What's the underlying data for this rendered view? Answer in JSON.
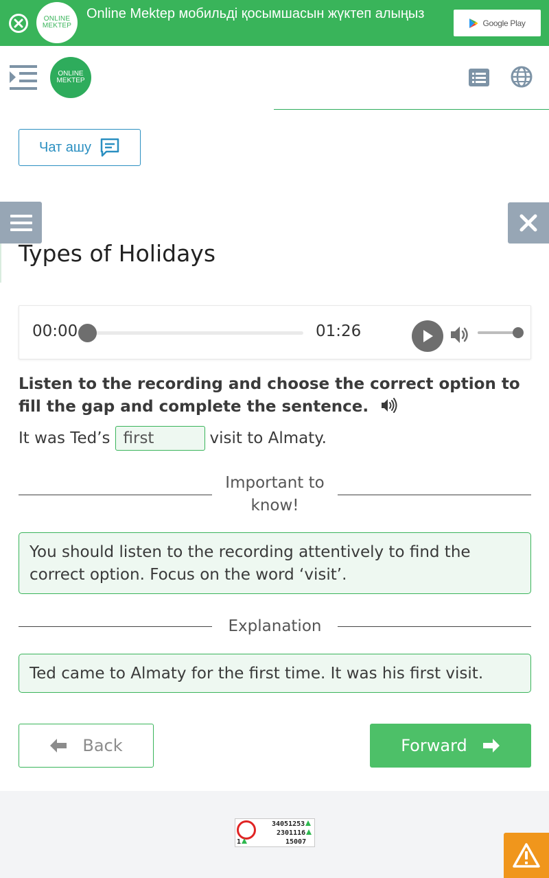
{
  "banner": {
    "logo_line1": "ONLINE",
    "logo_line2": "MEKTEP",
    "text": "Online Mektep мобильді қосымшасын жүктеп алыңыз",
    "store_label": "Google Play"
  },
  "header": {
    "logo_line1": "ONLINE",
    "logo_line2": "MEKTEP"
  },
  "chat": {
    "label": "Чат ашу"
  },
  "lesson": {
    "title": "Types of Holidays"
  },
  "audio": {
    "current_time": "00:00",
    "duration": "01:26",
    "progress": 0,
    "volume": 1
  },
  "task": {
    "instruction": "Listen to the recording and choose the correct option to fill the gap and complete the sentence.",
    "sentence_before": "It was Ted’s",
    "gap_answer": "first",
    "sentence_after": "visit to Almaty."
  },
  "important": {
    "title": "Important to know!",
    "text": "You should listen to the recording attentively to find the correct option. Focus on the word ‘visit’."
  },
  "explanation": {
    "title": "Explanation",
    "text": "Ted came to Almaty for the first time. It was his first visit."
  },
  "nav": {
    "back_label": "Back",
    "forward_label": "Forward"
  },
  "counter": {
    "line1": "34051253",
    "line2": "2301116",
    "line3": "15007",
    "left": "1"
  },
  "colors": {
    "brand_green": "#39b45a",
    "link_blue": "#2a8fc1",
    "panel_gray": "#97a6b5",
    "warning_orange": "#f0961c"
  },
  "icons": [
    "close-circle-icon",
    "google-play-icon",
    "menu-indent-icon",
    "list-icon",
    "globe-icon",
    "chat-icon",
    "hamburger-icon",
    "close-icon",
    "play-icon",
    "volume-icon",
    "speaker-icon",
    "arrow-left-icon",
    "arrow-right-icon",
    "warning-icon"
  ]
}
